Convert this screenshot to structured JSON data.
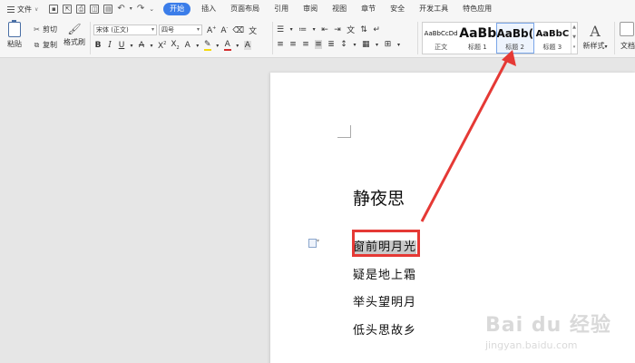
{
  "menubar": {
    "file_label": "文件",
    "tabs": [
      "开始",
      "插入",
      "页面布局",
      "引用",
      "审阅",
      "视图",
      "章节",
      "安全",
      "开发工具",
      "特色应用"
    ],
    "active_tab": "开始",
    "accent_color": "#3b7de9"
  },
  "ribbon": {
    "paste_label": "粘贴",
    "cut_label": "剪切",
    "copy_label": "复制",
    "format_painter_label": "格式刷",
    "font_name": "宋体 (正文)",
    "font_size": "四号",
    "styles": [
      {
        "preview": "AaBbCcDd",
        "name": "正文"
      },
      {
        "preview": "AaBb",
        "name": "标题 1"
      },
      {
        "preview": "AaBb(",
        "name": "标题 2"
      },
      {
        "preview": "AaBbC",
        "name": "标题 3"
      }
    ],
    "selected_style": "标题 2",
    "new_style_label": "新样式",
    "overflow_label": "文档"
  },
  "document": {
    "title": "静夜思",
    "lines": [
      "窗前明月光",
      "疑是地上霜",
      "举头望明月",
      "低头思故乡"
    ],
    "selected_line_index": 0
  },
  "annotation": {
    "box_color": "#e53935",
    "arrow_color": "#e53935"
  },
  "watermark": {
    "text": "Bai du 经验",
    "url": "jingyan.baidu.com"
  }
}
